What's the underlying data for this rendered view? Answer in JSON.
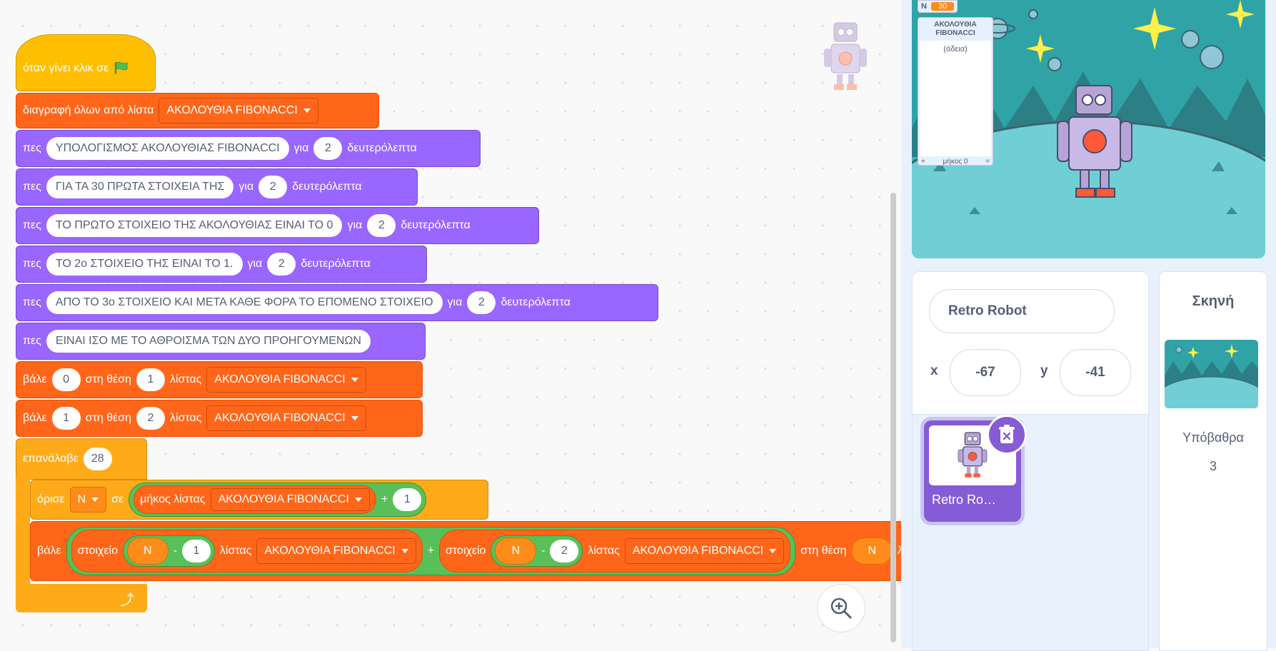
{
  "blocks": {
    "when_flag": "όταν γίνει κλικ σε",
    "delete_all": "διαγραφή όλων από λίστα",
    "list_name": "ΑΚΟΛΟΥΘΙΑ FIBONACCI",
    "say": "πες",
    "for": "για",
    "seconds": "δευτερόλεπτα",
    "say1_text": "ΥΠΟΛΟΓΙΣΜΟΣ ΑΚΟΛΟΥΘΙΑΣ FIBONACCI",
    "say2_text": "ΓΙΑ ΤΑ 30 ΠΡΩΤΑ ΣΤΟΙΧΕΙΑ ΤΗΣ",
    "say3_text": "ΤΟ ΠΡΩΤΟ ΣΤΟΙΧΕΙΟ ΤΗΣ ΑΚΟΛΟΥΘΙΑΣ ΕΙΝΑΙ ΤΟ 0",
    "say4_text": "ΤΟ 2ο ΣΤΟΙΧΕΙΟ ΤΗΣ ΕΙΝΑΙ ΤΟ 1.",
    "say5_text": "ΑΠΟ ΤΟ 3ο ΣΤΟΙΧΕΙΟ ΚΑΙ ΜΕΤΑ  ΚΑΘΕ ΦΟΡΑ ΤΟ ΕΠΟΜΕΝΟ ΣΤΟΙΧΕΙΟ",
    "say6_text": "ΕΙΝΑΙ ΙΣΟ ΜΕ ΤΟ ΑΘΡΟΙΣΜΑ ΤΩΝ ΔΥΟ ΠΡΟΗΓΟΥΜΕΝΩΝ",
    "two": "2",
    "put": "βάλε",
    "at_pos": "στη θέση",
    "of_list": "λίστας",
    "zero": "0",
    "one": "1",
    "repeat": "επανάλαβε",
    "repeat_count": "28",
    "set": "όρισε",
    "var_n": "N",
    "to": "σε",
    "length_of": "μήκος λίστας",
    "plus": "+",
    "minus": "-",
    "item": "στοιχείο",
    "loop_arrow": "⤴"
  },
  "stage": {
    "var_monitor_label": "N",
    "var_monitor_value": "30",
    "list_monitor_title": "ΑΚΟΛΟΥΘΙΑ FIBONACCI",
    "list_monitor_empty": "(άδεια)",
    "list_monitor_add": "+",
    "list_monitor_length": "μήκος 0",
    "list_monitor_resize": "="
  },
  "sprite_info": {
    "name": "Retro Robot",
    "x_label": "x",
    "x_value": "-67",
    "y_label": "y",
    "y_value": "-41"
  },
  "sprite_list": {
    "items": [
      {
        "name": "Retro Ro…"
      }
    ]
  },
  "stage_panel": {
    "title": "Σκηνή",
    "backdrops_label": "Υπόβαθρα",
    "backdrops_count": "3"
  },
  "colors": {
    "events": "#ffbf00",
    "looks": "#9966ff",
    "lists": "#ff661a",
    "control": "#ffab19",
    "operators": "#59c059",
    "variables": "#ff8c1a",
    "sprite_selected": "#855cd6"
  }
}
